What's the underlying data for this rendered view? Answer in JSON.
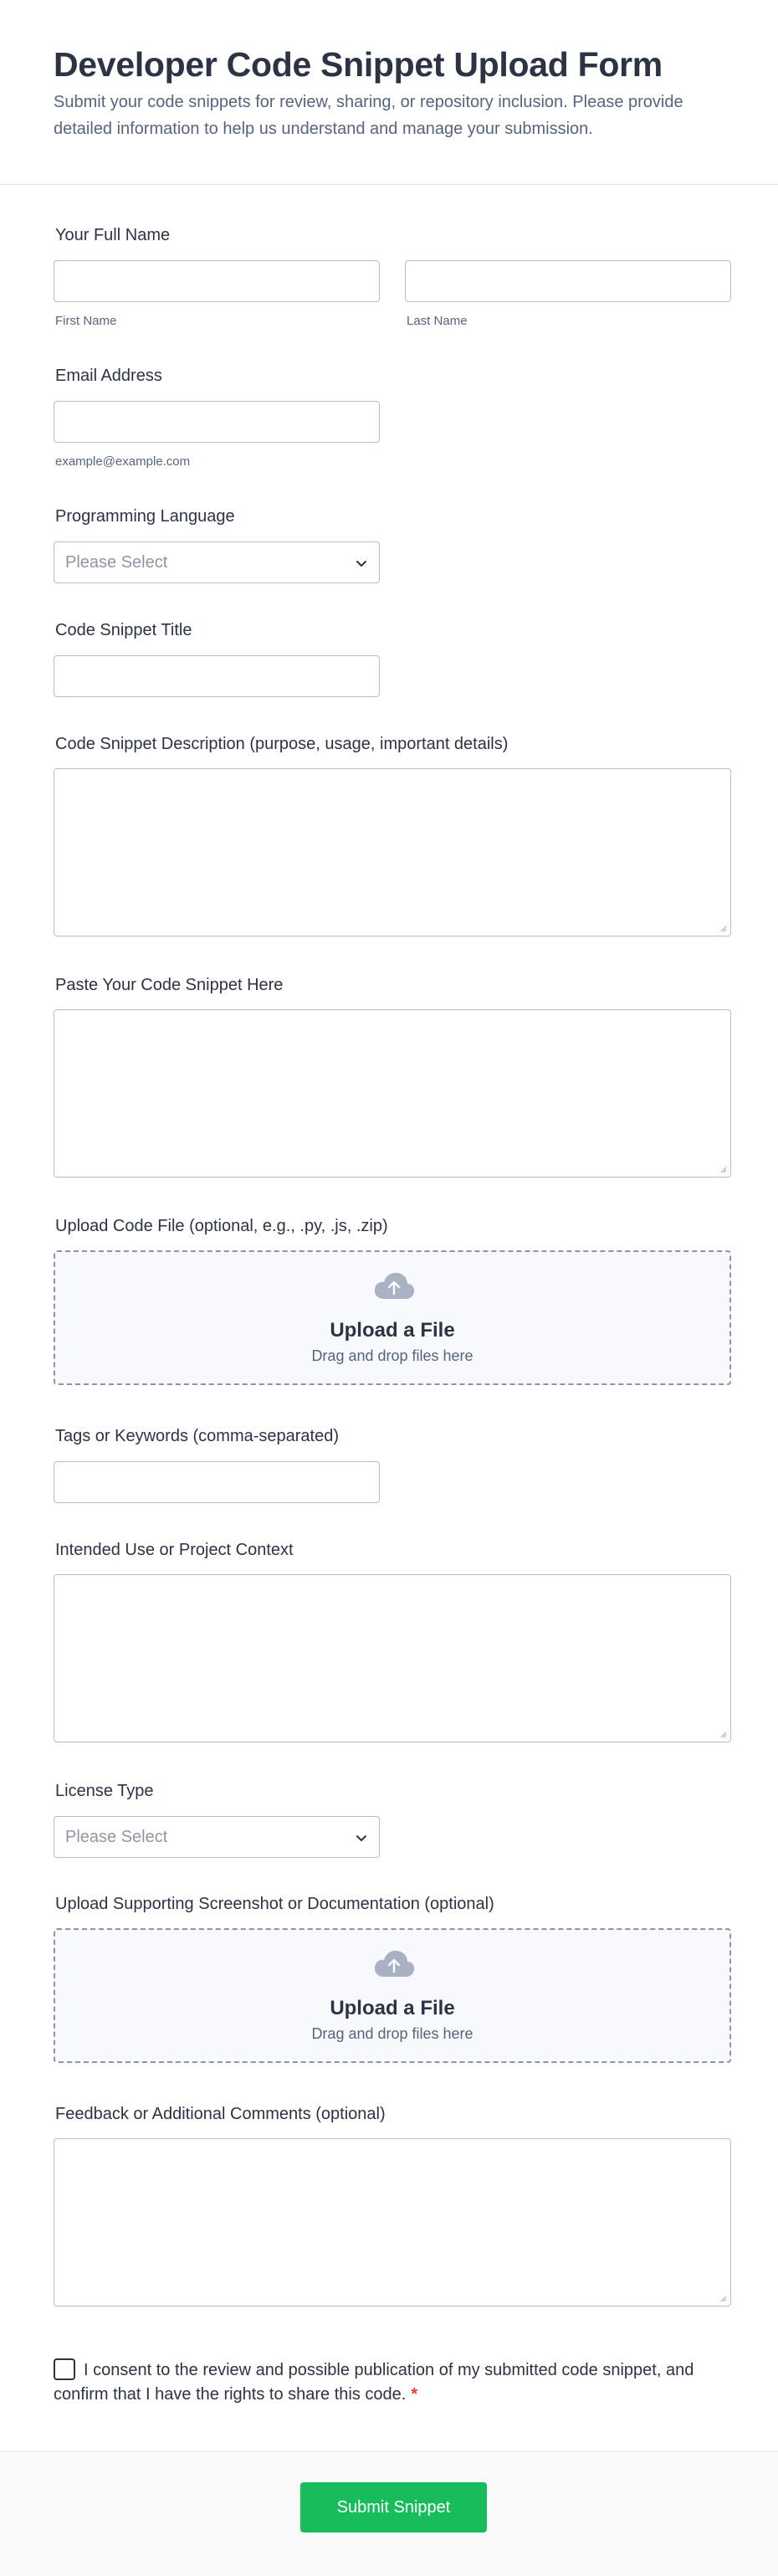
{
  "header": {
    "title": "Developer Code Snippet Upload Form",
    "description": "Submit your code snippets for review, sharing, or repository inclusion. Please provide detailed information to help us understand and manage your submission."
  },
  "fields": {
    "full_name": {
      "label": "Your Full Name",
      "first_sublabel": "First Name",
      "last_sublabel": "Last Name"
    },
    "email": {
      "label": "Email Address",
      "sublabel": "example@example.com"
    },
    "language": {
      "label": "Programming Language",
      "placeholder": "Please Select"
    },
    "snippet_title": {
      "label": "Code Snippet Title"
    },
    "description": {
      "label": "Code Snippet Description (purpose, usage, important details)"
    },
    "code": {
      "label": "Paste Your Code Snippet Here"
    },
    "code_file": {
      "label": "Upload Code File (optional, e.g., .py, .js, .zip)",
      "button": "Upload a File",
      "hint": "Drag and drop files here"
    },
    "tags": {
      "label": "Tags or Keywords (comma-separated)"
    },
    "intended_use": {
      "label": "Intended Use or Project Context"
    },
    "license": {
      "label": "License Type",
      "placeholder": "Please Select"
    },
    "supporting": {
      "label": "Upload Supporting Screenshot or Documentation (optional)",
      "button": "Upload a File",
      "hint": "Drag and drop files here"
    },
    "feedback": {
      "label": "Feedback or Additional Comments (optional)"
    },
    "consent": {
      "text": "I consent to the review and possible publication of my submitted code snippet, and confirm that I have the rights to share this code.",
      "required_mark": "*"
    }
  },
  "submit": {
    "label": "Submit Snippet"
  },
  "colors": {
    "accent": "#18bd5b",
    "required": "#f23a3c",
    "text": "#2c3345",
    "muted": "#57647e"
  }
}
